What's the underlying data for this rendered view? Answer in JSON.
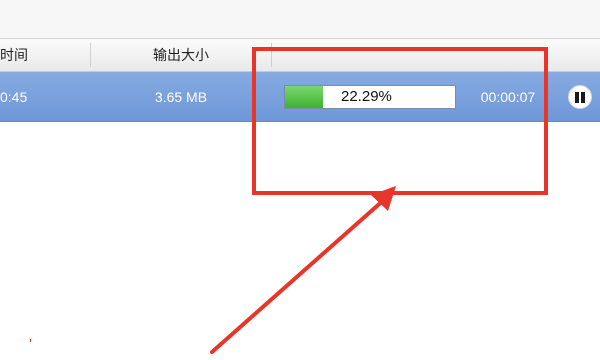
{
  "columns": {
    "time": "时间",
    "output_size": "输出大小"
  },
  "task": {
    "time_partial": "0:45",
    "output_size": "3.65 MB",
    "progress_percent": 22.29,
    "progress_label": "22.29%",
    "elapsed": "00:00:07"
  },
  "colors": {
    "row_selected": "#7da3de",
    "progress_fill": "#4cbc3f",
    "annotation": "#e8352a"
  },
  "icons": {
    "pause": "pause-icon"
  }
}
